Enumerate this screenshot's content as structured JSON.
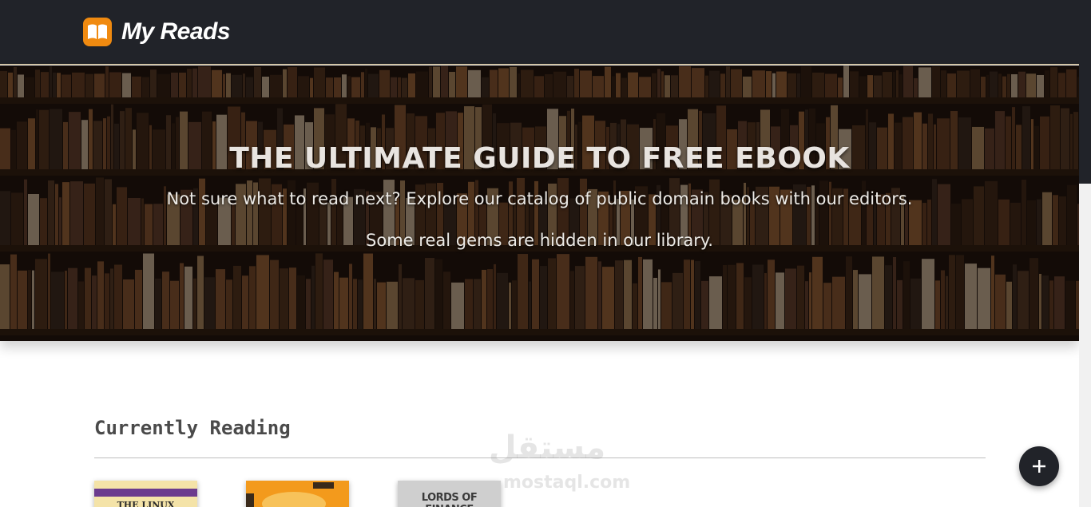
{
  "brand": {
    "name": "My Reads",
    "accent_color": "#f08a10",
    "logo_icon": "open-book-icon"
  },
  "hero": {
    "title": "THE ULTIMATE GUIDE TO FREE EBOOK",
    "subtitle_line1": "Not sure what to read next? Explore our catalog of public domain books with our editors.",
    "subtitle_line2": "Some real gems are hidden in our library."
  },
  "shelf": {
    "title": "Currently Reading",
    "books": [
      {
        "cover_text": "THE LINUX"
      },
      {
        "cover_text": ""
      },
      {
        "cover_text": "LORDS OF FINANCE"
      }
    ]
  },
  "watermark": {
    "text_ar": "مستقل",
    "text_en": "mostaql.com"
  },
  "fab": {
    "icon": "plus-icon"
  },
  "colors": {
    "navbar": "#212329",
    "heading": "#4a4a4a"
  }
}
